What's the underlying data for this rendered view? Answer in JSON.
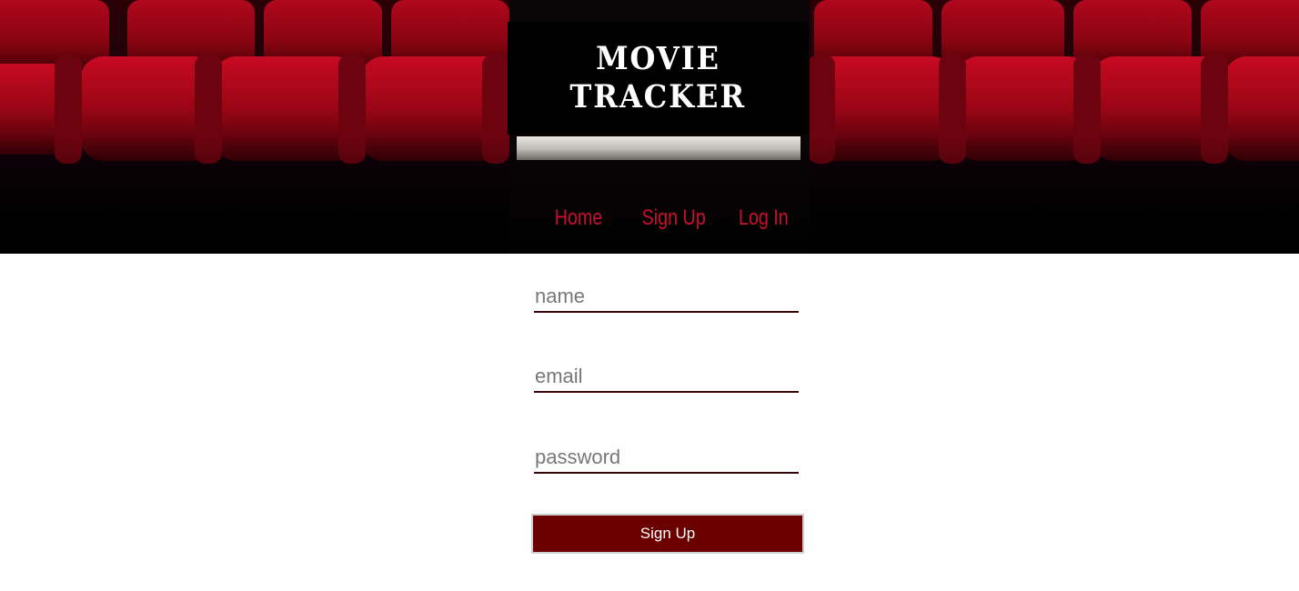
{
  "header": {
    "logo_line1": "MOVIE",
    "logo_line2": "TRACKER"
  },
  "nav": {
    "items": [
      {
        "label": "Home"
      },
      {
        "label": "Sign Up"
      },
      {
        "label": "Log In"
      }
    ]
  },
  "form": {
    "name_placeholder": "name",
    "email_placeholder": "email",
    "password_placeholder": "password",
    "submit_label": "Sign Up"
  },
  "colors": {
    "nav_link": "#c8102e",
    "button_bg": "#6b0000",
    "field_underline": "#3a0508",
    "logo_box": "#000000",
    "seat_red": "#a00617"
  }
}
